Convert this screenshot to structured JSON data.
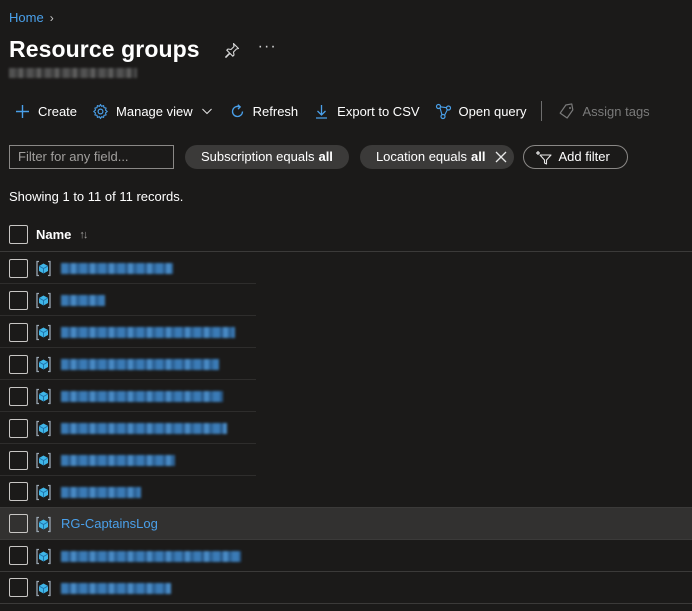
{
  "breadcrumb": {
    "home": "Home"
  },
  "page": {
    "title": "Resource groups"
  },
  "toolbar": {
    "create": "Create",
    "manage_view": "Manage view",
    "refresh": "Refresh",
    "export_csv": "Export to CSV",
    "open_query": "Open query",
    "assign_tags": "Assign tags"
  },
  "filters": {
    "search_placeholder": "Filter for any field...",
    "subscription_label": "Subscription equals",
    "subscription_value": "all",
    "location_label": "Location equals",
    "location_value": "all",
    "add_filter": "Add filter"
  },
  "records": {
    "summary": "Showing 1 to 11 of 11 records."
  },
  "grid": {
    "name_header": "Name",
    "rows": [
      {
        "name": "",
        "redacted": true
      },
      {
        "name": "",
        "redacted": true
      },
      {
        "name": "",
        "redacted": true
      },
      {
        "name": "",
        "redacted": true
      },
      {
        "name": "",
        "redacted": true
      },
      {
        "name": "",
        "redacted": true
      },
      {
        "name": "",
        "redacted": true
      },
      {
        "name": "",
        "redacted": true
      },
      {
        "name": "RG-CaptainsLog",
        "redacted": false,
        "selected": true
      },
      {
        "name": "",
        "redacted": true
      },
      {
        "name": "",
        "redacted": true
      }
    ]
  },
  "colors": {
    "accent": "#4aa0ea",
    "background": "#1b1a19",
    "pill": "#3b3a39",
    "selected_row": "#323130"
  }
}
